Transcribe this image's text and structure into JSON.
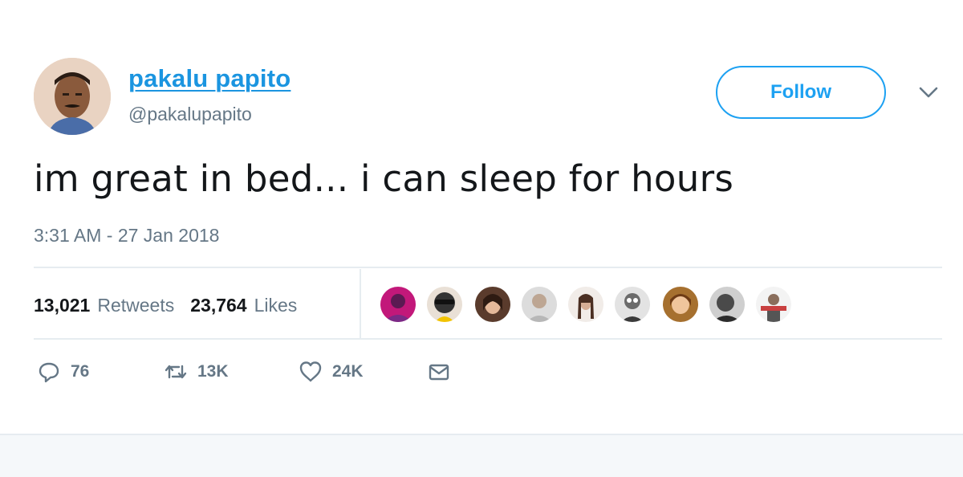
{
  "tweet": {
    "author": {
      "display_name": "pakalu papito",
      "handle": "@pakalupapito"
    },
    "follow_label": "Follow",
    "text": "im great in bed... i can sleep for hours",
    "timestamp": "3:31 AM - 27 Jan 2018",
    "stats": {
      "retweets_count": "13,021",
      "retweets_label": "Retweets",
      "likes_count": "23,764",
      "likes_label": "Likes"
    },
    "likers_count_shown": 9,
    "actions": {
      "reply_count": "76",
      "retweet_count": "13K",
      "like_count": "24K"
    }
  },
  "icons": {
    "more": "chevron-down-icon",
    "reply": "reply-icon",
    "retweet": "retweet-icon",
    "like": "heart-icon",
    "dm": "envelope-icon"
  },
  "colors": {
    "accent": "#1da1f2",
    "name_link": "#1b95e0",
    "secondary_text": "#657786",
    "divider": "#e6ecf0"
  }
}
